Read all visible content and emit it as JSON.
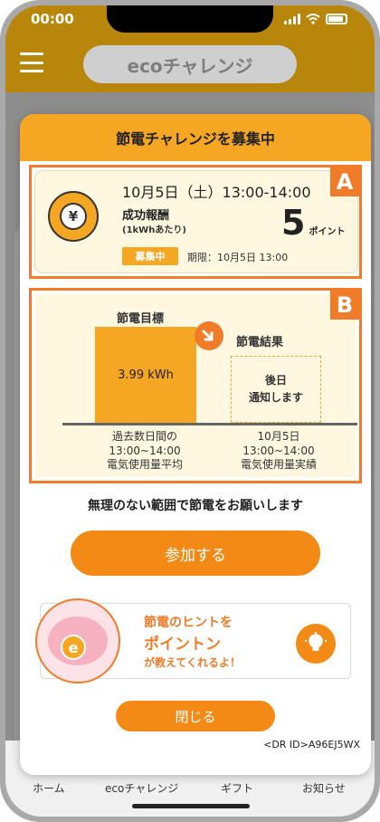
{
  "status_bar": {
    "time": "00:00"
  },
  "header": {
    "title": "ecoチャレンジ"
  },
  "bottom_nav": {
    "items": [
      {
        "label": "ホーム"
      },
      {
        "label": "ecoチャレンジ"
      },
      {
        "label": "ギフト"
      },
      {
        "label": "お知らせ"
      }
    ]
  },
  "modal": {
    "title": "節電チャレンジを募集中",
    "section_a": {
      "tag": "A",
      "datetime": "10月5日（土）13:00-14:00",
      "reward_label": "成功報酬",
      "reward_sub": "(1kWhあたり)",
      "points_value": "5",
      "points_unit": "ポイント",
      "badge": "募集中",
      "deadline": "期限：10月5日 13:00"
    },
    "section_b": {
      "tag": "B",
      "target_label": "節電目標",
      "target_value": "3.99 kWh",
      "result_label": "節電結果",
      "pending_line1": "後日",
      "pending_line2": "通知します",
      "caption_left": [
        "過去数日間の",
        "13:00~14:00",
        "電気使用量平均"
      ],
      "caption_right": [
        "10月5日",
        "13:00~14:00",
        "電気使用量実績"
      ]
    },
    "request_text": "無理のない範囲で節電をお願いします",
    "join_label": "参加する",
    "hint": {
      "line1": "節電のヒントを",
      "line2": "ポイントン",
      "line3": "が教えてくれるよ！",
      "coin_letter": "e"
    },
    "close_label": "閉じる",
    "dr_id": "<DR ID>A96EJ5WX"
  },
  "colors": {
    "accent": "#f28a15",
    "header_bg": "#f5a623",
    "tag_border": "#f07c2a",
    "panel_bg": "#fff7e0",
    "outer_bg": "#b8860b"
  }
}
